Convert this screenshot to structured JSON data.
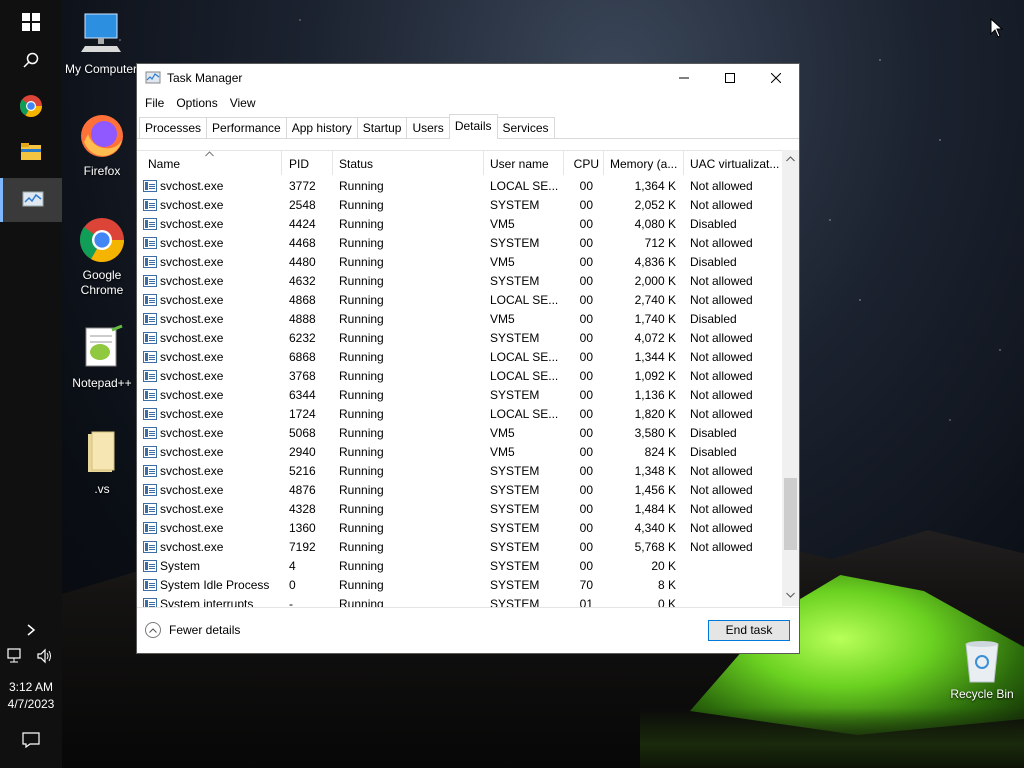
{
  "desktop": {
    "icons": [
      {
        "label": "My Computer"
      },
      {
        "label": "Firefox"
      },
      {
        "label": "Google Chrome"
      },
      {
        "label": "Notepad++"
      },
      {
        "label": ".vs"
      }
    ],
    "recycle_bin": "Recycle Bin"
  },
  "taskbar": {
    "time": "3:12 AM",
    "date": "4/7/2023"
  },
  "window": {
    "title": "Task Manager",
    "menu": [
      "File",
      "Options",
      "View"
    ],
    "tabs": [
      "Processes",
      "Performance",
      "App history",
      "Startup",
      "Users",
      "Details",
      "Services"
    ],
    "selected_tab": "Details",
    "columns": [
      "Name",
      "PID",
      "Status",
      "User name",
      "CPU",
      "Memory (a...",
      "UAC virtualizat..."
    ],
    "rows": [
      {
        "name": "svchost.exe",
        "pid": "3772",
        "status": "Running",
        "user": "LOCAL SE...",
        "cpu": "00",
        "mem": "1,364 K",
        "uac": "Not allowed"
      },
      {
        "name": "svchost.exe",
        "pid": "2548",
        "status": "Running",
        "user": "SYSTEM",
        "cpu": "00",
        "mem": "2,052 K",
        "uac": "Not allowed"
      },
      {
        "name": "svchost.exe",
        "pid": "4424",
        "status": "Running",
        "user": "VM5",
        "cpu": "00",
        "mem": "4,080 K",
        "uac": "Disabled"
      },
      {
        "name": "svchost.exe",
        "pid": "4468",
        "status": "Running",
        "user": "SYSTEM",
        "cpu": "00",
        "mem": "712 K",
        "uac": "Not allowed"
      },
      {
        "name": "svchost.exe",
        "pid": "4480",
        "status": "Running",
        "user": "VM5",
        "cpu": "00",
        "mem": "4,836 K",
        "uac": "Disabled"
      },
      {
        "name": "svchost.exe",
        "pid": "4632",
        "status": "Running",
        "user": "SYSTEM",
        "cpu": "00",
        "mem": "2,000 K",
        "uac": "Not allowed"
      },
      {
        "name": "svchost.exe",
        "pid": "4868",
        "status": "Running",
        "user": "LOCAL SE...",
        "cpu": "00",
        "mem": "2,740 K",
        "uac": "Not allowed"
      },
      {
        "name": "svchost.exe",
        "pid": "4888",
        "status": "Running",
        "user": "VM5",
        "cpu": "00",
        "mem": "1,740 K",
        "uac": "Disabled"
      },
      {
        "name": "svchost.exe",
        "pid": "6232",
        "status": "Running",
        "user": "SYSTEM",
        "cpu": "00",
        "mem": "4,072 K",
        "uac": "Not allowed"
      },
      {
        "name": "svchost.exe",
        "pid": "6868",
        "status": "Running",
        "user": "LOCAL SE...",
        "cpu": "00",
        "mem": "1,344 K",
        "uac": "Not allowed"
      },
      {
        "name": "svchost.exe",
        "pid": "3768",
        "status": "Running",
        "user": "LOCAL SE...",
        "cpu": "00",
        "mem": "1,092 K",
        "uac": "Not allowed"
      },
      {
        "name": "svchost.exe",
        "pid": "6344",
        "status": "Running",
        "user": "SYSTEM",
        "cpu": "00",
        "mem": "1,136 K",
        "uac": "Not allowed"
      },
      {
        "name": "svchost.exe",
        "pid": "1724",
        "status": "Running",
        "user": "LOCAL SE...",
        "cpu": "00",
        "mem": "1,820 K",
        "uac": "Not allowed"
      },
      {
        "name": "svchost.exe",
        "pid": "5068",
        "status": "Running",
        "user": "VM5",
        "cpu": "00",
        "mem": "3,580 K",
        "uac": "Disabled"
      },
      {
        "name": "svchost.exe",
        "pid": "2940",
        "status": "Running",
        "user": "VM5",
        "cpu": "00",
        "mem": "824 K",
        "uac": "Disabled"
      },
      {
        "name": "svchost.exe",
        "pid": "5216",
        "status": "Running",
        "user": "SYSTEM",
        "cpu": "00",
        "mem": "1,348 K",
        "uac": "Not allowed"
      },
      {
        "name": "svchost.exe",
        "pid": "4876",
        "status": "Running",
        "user": "SYSTEM",
        "cpu": "00",
        "mem": "1,456 K",
        "uac": "Not allowed"
      },
      {
        "name": "svchost.exe",
        "pid": "4328",
        "status": "Running",
        "user": "SYSTEM",
        "cpu": "00",
        "mem": "1,484 K",
        "uac": "Not allowed"
      },
      {
        "name": "svchost.exe",
        "pid": "1360",
        "status": "Running",
        "user": "SYSTEM",
        "cpu": "00",
        "mem": "4,340 K",
        "uac": "Not allowed"
      },
      {
        "name": "svchost.exe",
        "pid": "7192",
        "status": "Running",
        "user": "SYSTEM",
        "cpu": "00",
        "mem": "5,768 K",
        "uac": "Not allowed"
      },
      {
        "name": "System",
        "pid": "4",
        "status": "Running",
        "user": "SYSTEM",
        "cpu": "00",
        "mem": "20 K",
        "uac": ""
      },
      {
        "name": "System Idle Process",
        "pid": "0",
        "status": "Running",
        "user": "SYSTEM",
        "cpu": "70",
        "mem": "8 K",
        "uac": ""
      },
      {
        "name": "System interrupts",
        "pid": "-",
        "status": "Running",
        "user": "SYSTEM",
        "cpu": "01",
        "mem": "0 K",
        "uac": ""
      }
    ],
    "fewer_details": "Fewer details",
    "end_task": "End task"
  },
  "colors": {
    "accent": "#0078d7",
    "taskbar": "#101010"
  }
}
